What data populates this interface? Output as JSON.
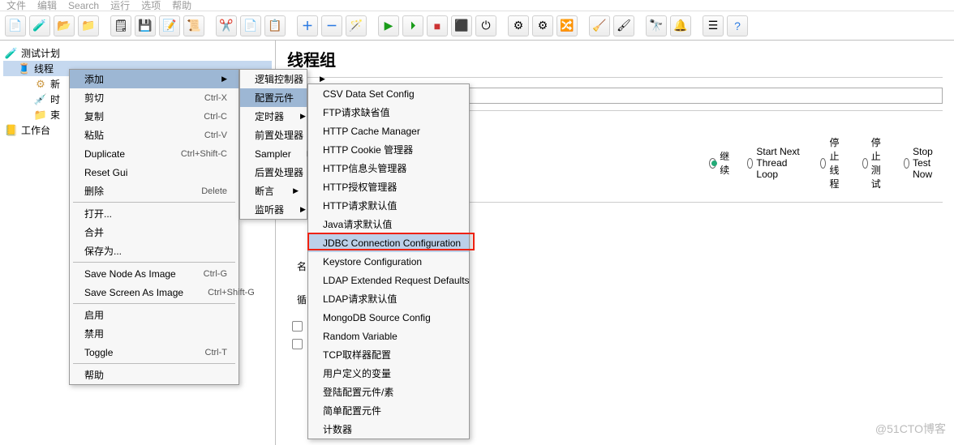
{
  "menubar": {
    "items": [
      "文件",
      "编辑",
      "Search",
      "运行",
      "选项",
      "帮助"
    ]
  },
  "toolbar_icons": [
    "file",
    "flask",
    "open",
    "save-all",
    "doc",
    "save",
    "note",
    "scroll-new",
    "",
    "cut",
    "copy",
    "paste",
    "",
    "plus",
    "minus",
    "wand",
    "",
    "play",
    "play-next",
    "stop",
    "stop-all",
    "shutdown",
    "",
    "gear1",
    "gear2",
    "toggle",
    "",
    "broom",
    "paint",
    "",
    "binoculars",
    "bell",
    "",
    "list",
    "help"
  ],
  "tree": {
    "root": "测试计划",
    "thread_group": "线程",
    "children": [
      "新",
      "时",
      "束"
    ],
    "workbench": "工作台"
  },
  "main": {
    "title": "线程组",
    "name_label": "名称:",
    "radios": {
      "continue": "继续",
      "start_next": "Start Next Thread Loop",
      "stop_thread": "停止线程",
      "stop_test": "停止测试",
      "stop_now": "Stop Test Now",
      "selected": "continue"
    },
    "loop_labels": {
      "name": "名",
      "loop": "循"
    }
  },
  "ctx1": [
    {
      "label": "添加",
      "arrow": true,
      "hl": true
    },
    {
      "label": "剪切",
      "shortcut": "Ctrl-X"
    },
    {
      "label": "复制",
      "shortcut": "Ctrl-C"
    },
    {
      "label": "粘贴",
      "shortcut": "Ctrl-V"
    },
    {
      "label": "Duplicate",
      "shortcut": "Ctrl+Shift-C"
    },
    {
      "label": "Reset Gui"
    },
    {
      "label": "删除",
      "shortcut": "Delete"
    },
    {
      "sep": true
    },
    {
      "label": "打开..."
    },
    {
      "label": "合并"
    },
    {
      "label": "保存为..."
    },
    {
      "sep": true
    },
    {
      "label": "Save Node As Image",
      "shortcut": "Ctrl-G"
    },
    {
      "label": "Save Screen As Image",
      "shortcut": "Ctrl+Shift-G"
    },
    {
      "sep": true
    },
    {
      "label": "启用"
    },
    {
      "label": "禁用"
    },
    {
      "label": "Toggle",
      "shortcut": "Ctrl-T"
    },
    {
      "sep": true
    },
    {
      "label": "帮助"
    }
  ],
  "ctx2": [
    {
      "label": "逻辑控制器",
      "arrow": true
    },
    {
      "label": "配置元件",
      "arrow": true,
      "hl": true
    },
    {
      "label": "定时器",
      "arrow": true
    },
    {
      "label": "前置处理器",
      "arrow": true
    },
    {
      "label": "Sampler",
      "arrow": true
    },
    {
      "label": "后置处理器",
      "arrow": true
    },
    {
      "label": "断言",
      "arrow": true
    },
    {
      "label": "监听器",
      "arrow": true
    }
  ],
  "ctx3": [
    {
      "label": "CSV Data Set Config"
    },
    {
      "label": "FTP请求缺省值"
    },
    {
      "label": "HTTP Cache Manager"
    },
    {
      "label": "HTTP Cookie 管理器"
    },
    {
      "label": "HTTP信息头管理器"
    },
    {
      "label": "HTTP授权管理器"
    },
    {
      "label": "HTTP请求默认值"
    },
    {
      "label": "Java请求默认值"
    },
    {
      "label": "JDBC Connection Configuration",
      "mark": true
    },
    {
      "label": "Keystore Configuration"
    },
    {
      "label": "LDAP Extended Request Defaults"
    },
    {
      "label": "LDAP请求默认值"
    },
    {
      "label": "MongoDB Source Config"
    },
    {
      "label": "Random Variable"
    },
    {
      "label": "TCP取样器配置"
    },
    {
      "label": "用户定义的变量"
    },
    {
      "label": "登陆配置元件/素"
    },
    {
      "label": "简单配置元件"
    },
    {
      "label": "计数器"
    }
  ],
  "watermark": "@51CTO博客"
}
